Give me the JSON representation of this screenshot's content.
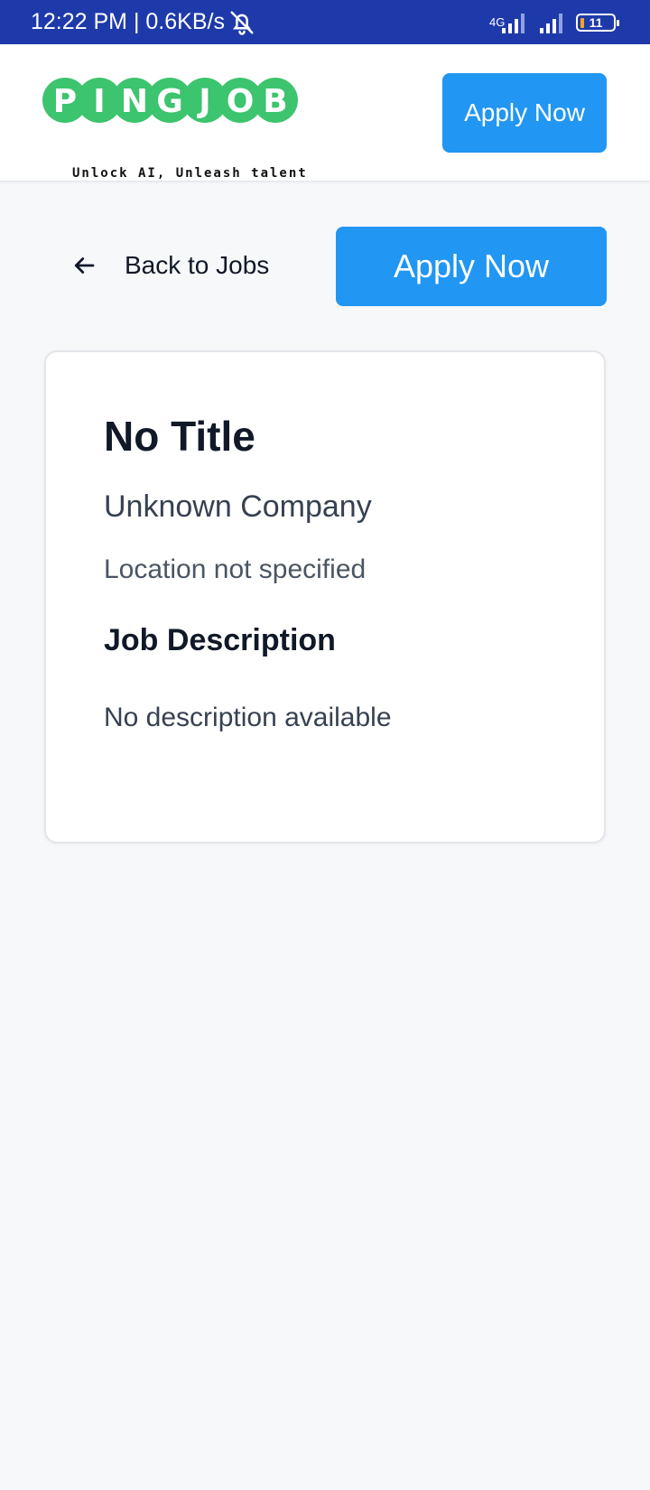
{
  "status_bar": {
    "time_speed": "12:22 PM | 0.6KB/s",
    "network_type": "4G",
    "battery_level": "11",
    "icons": [
      "alarm-off-icon",
      "signal-icon",
      "signal-icon",
      "battery-icon"
    ]
  },
  "header": {
    "logo_text": "PINGJOB",
    "logo_tagline": "Unlock AI, Unleash talent",
    "apply_label": "Apply Now"
  },
  "actions": {
    "back_label": "Back to Jobs",
    "apply_label": "Apply Now"
  },
  "job": {
    "title": "No Title",
    "company": "Unknown Company",
    "location": "Location not specified",
    "description_heading": "Job Description",
    "description": "No description available"
  },
  "colors": {
    "status_bar": "#1e3aaa",
    "primary": "#2196f3",
    "logo_green": "#3cc46e",
    "background": "#f7f8fa"
  }
}
